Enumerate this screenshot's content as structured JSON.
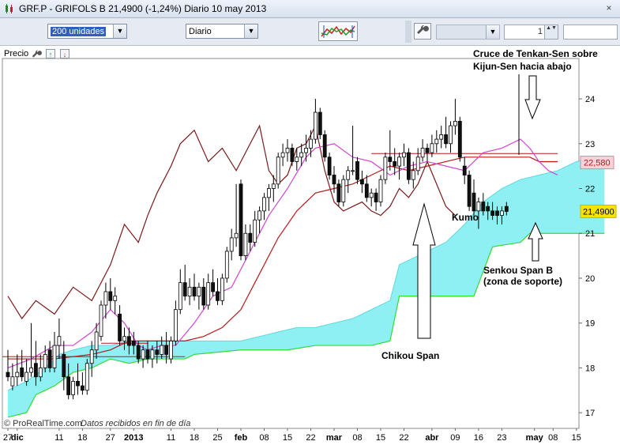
{
  "window": {
    "title": "GRF.P - GRIFOLS B   21,4900 (-1,24%)   Diario  10 may 2013",
    "close_glyph": "×"
  },
  "toolbar": {
    "units_value": "200 unidades",
    "period_value": "Diario",
    "spin_value": "1",
    "dropdown_arrow": "▼",
    "spin_arrows": "▲▼"
  },
  "chart_header": {
    "label": "Precio",
    "up_glyph": "↑",
    "down_glyph": "↓"
  },
  "icons": {
    "app": "candlestick-app-icon",
    "close": "close-icon",
    "wrench": "wrench-icon",
    "chart_style": "chart-indicator-icon"
  },
  "colors": {
    "kumo_fill": "#8ff0f4",
    "senkou_b": "#33dd33",
    "senkou_a": "#8ff0f4",
    "tenkan": "#d045d0",
    "kijun": "#b81818",
    "chikou": "#7a1a1a",
    "price_tag_yellow": "#f7e300",
    "price_tag_pink": "#f7d2da"
  },
  "chart_data": {
    "type": "candlestick",
    "instrument": "GRF.P - GRIFOLS B",
    "last_price": "21,4900",
    "change": "-1,24%",
    "timeframe": "Diario",
    "ylim": [
      16.65,
      24.9
    ],
    "y_ticks": [
      17,
      18,
      19,
      20,
      21,
      22,
      23,
      24
    ],
    "price_labels": {
      "kijun": "22,580",
      "last": "21,4900"
    },
    "x_ticks": [
      {
        "label": "27",
        "day": 0
      },
      {
        "label": "dic",
        "day": 2,
        "bold": true
      },
      {
        "label": "11",
        "day": 11
      },
      {
        "label": "18",
        "day": 16
      },
      {
        "label": "27",
        "day": 22
      },
      {
        "label": "2013",
        "day": 27,
        "bold": true
      },
      {
        "label": "11",
        "day": 35
      },
      {
        "label": "18",
        "day": 40
      },
      {
        "label": "25",
        "day": 45
      },
      {
        "label": "feb",
        "day": 50,
        "bold": true
      },
      {
        "label": "08",
        "day": 55
      },
      {
        "label": "15",
        "day": 60
      },
      {
        "label": "22",
        "day": 65
      },
      {
        "label": "mar",
        "day": 70,
        "bold": true
      },
      {
        "label": "08",
        "day": 75
      },
      {
        "label": "15",
        "day": 80
      },
      {
        "label": "22",
        "day": 85
      },
      {
        "label": "abr",
        "day": 91,
        "bold": true
      },
      {
        "label": "09",
        "day": 96
      },
      {
        "label": "16",
        "day": 101
      },
      {
        "label": "23",
        "day": 106
      },
      {
        "label": "may",
        "day": 113,
        "bold": true
      },
      {
        "label": "08",
        "day": 117
      },
      {
        "label": "15",
        "day": 122
      }
    ],
    "closes": [
      17.8,
      17.8,
      17.9,
      17.8,
      17.9,
      18.0,
      17.9,
      17.9,
      18.2,
      18.0,
      18.3,
      18.6,
      17.9,
      17.8,
      17.5,
      17.6,
      17.6,
      17.9,
      18.2,
      18.5,
      18.8,
      19.4,
      19.5,
      19.7,
      19.4,
      18.7,
      18.7,
      18.5,
      18.4,
      18.2,
      18.3,
      18.4,
      18.3,
      18.3,
      18.6,
      18.4,
      19.0,
      19.6,
      19.8,
      19.6,
      19.7,
      19.7,
      19.5,
      19.8,
      19.9,
      19.7,
      19.6,
      19.9,
      20.5,
      20.9,
      22.2,
      21.0,
      20.8,
      20.9,
      21.3,
      21.5,
      21.8,
      22.0,
      22.1,
      22.7,
      22.8,
      22.9,
      22.7,
      22.6,
      22.8,
      22.9,
      23.1,
      23.2,
      22.9,
      22.3,
      22.1,
      21.9,
      21.9,
      22.2,
      22.4,
      22.4,
      22.2,
      22.1,
      21.8,
      21.8,
      21.7,
      22.2,
      22.7,
      22.6,
      22.6,
      22.7,
      22.8,
      22.4,
      22.4,
      22.7,
      22.9,
      22.8,
      23.0,
      23.1,
      23.2,
      23.2,
      23.4,
      23.1,
      22.5,
      22.3,
      21.8,
      21.6,
      21.5,
      21.5,
      21.6,
      21.5,
      21.5,
      21.4,
      21.5,
      21.5
    ],
    "candles": [
      {
        "o": 17.9,
        "h": 18.4,
        "l": 17.7,
        "c": 17.8
      },
      {
        "o": 17.6,
        "h": 18.1,
        "l": 17.5,
        "c": 17.8
      },
      {
        "o": 17.8,
        "h": 18.3,
        "l": 17.6,
        "c": 17.9
      },
      {
        "o": 18.0,
        "h": 18.4,
        "l": 17.7,
        "c": 17.8
      },
      {
        "o": 17.7,
        "h": 18.2,
        "l": 17.6,
        "c": 17.9
      },
      {
        "o": 17.9,
        "h": 19.0,
        "l": 17.8,
        "c": 18.0
      },
      {
        "o": 18.1,
        "h": 18.6,
        "l": 17.6,
        "c": 17.8
      },
      {
        "o": 17.8,
        "h": 18.3,
        "l": 17.7,
        "c": 18.0
      },
      {
        "o": 18.0,
        "h": 18.5,
        "l": 17.9,
        "c": 18.3
      },
      {
        "o": 18.4,
        "h": 18.6,
        "l": 17.9,
        "c": 18.0
      },
      {
        "o": 18.0,
        "h": 18.8,
        "l": 17.9,
        "c": 18.5
      },
      {
        "o": 18.5,
        "h": 19.1,
        "l": 18.2,
        "c": 18.7
      },
      {
        "o": 18.3,
        "h": 18.6,
        "l": 17.5,
        "c": 17.8
      },
      {
        "o": 17.8,
        "h": 18.1,
        "l": 17.3,
        "c": 17.4
      },
      {
        "o": 17.4,
        "h": 17.8,
        "l": 17.3,
        "c": 17.7
      },
      {
        "o": 17.7,
        "h": 18.1,
        "l": 17.4,
        "c": 17.6
      },
      {
        "o": 17.6,
        "h": 17.9,
        "l": 17.4,
        "c": 17.5
      },
      {
        "o": 17.5,
        "h": 18.2,
        "l": 17.4,
        "c": 18.1
      },
      {
        "o": 18.1,
        "h": 18.6,
        "l": 17.8,
        "c": 18.4
      },
      {
        "o": 18.4,
        "h": 19.0,
        "l": 18.2,
        "c": 18.8
      },
      {
        "o": 18.7,
        "h": 19.5,
        "l": 18.6,
        "c": 19.4
      },
      {
        "o": 19.4,
        "h": 19.9,
        "l": 19.1,
        "c": 19.7
      },
      {
        "o": 19.7,
        "h": 20.0,
        "l": 19.3,
        "c": 19.5
      },
      {
        "o": 19.5,
        "h": 19.8,
        "l": 19.2,
        "c": 19.6
      },
      {
        "o": 19.2,
        "h": 19.4,
        "l": 18.5,
        "c": 18.6
      },
      {
        "o": 18.6,
        "h": 18.9,
        "l": 18.4,
        "c": 18.7
      },
      {
        "o": 18.7,
        "h": 18.9,
        "l": 18.3,
        "c": 18.5
      },
      {
        "o": 18.6,
        "h": 18.8,
        "l": 18.3,
        "c": 18.5
      },
      {
        "o": 18.5,
        "h": 18.6,
        "l": 18.1,
        "c": 18.2
      },
      {
        "o": 18.2,
        "h": 18.5,
        "l": 18.0,
        "c": 18.4
      },
      {
        "o": 18.4,
        "h": 18.6,
        "l": 18.1,
        "c": 18.2
      },
      {
        "o": 18.2,
        "h": 18.5,
        "l": 18.0,
        "c": 18.4
      },
      {
        "o": 18.4,
        "h": 18.6,
        "l": 18.1,
        "c": 18.3
      },
      {
        "o": 18.3,
        "h": 18.7,
        "l": 18.2,
        "c": 18.5
      },
      {
        "o": 18.5,
        "h": 18.8,
        "l": 18.1,
        "c": 18.3
      },
      {
        "o": 18.2,
        "h": 18.7,
        "l": 18.1,
        "c": 18.6
      },
      {
        "o": 18.6,
        "h": 19.5,
        "l": 18.5,
        "c": 19.3
      },
      {
        "o": 19.3,
        "h": 20.2,
        "l": 19.2,
        "c": 19.9
      },
      {
        "o": 19.9,
        "h": 20.3,
        "l": 19.5,
        "c": 19.6
      },
      {
        "o": 19.6,
        "h": 20.0,
        "l": 19.4,
        "c": 19.8
      },
      {
        "o": 19.8,
        "h": 20.1,
        "l": 19.5,
        "c": 19.6
      },
      {
        "o": 19.6,
        "h": 19.9,
        "l": 19.3,
        "c": 19.8
      },
      {
        "o": 19.8,
        "h": 20.0,
        "l": 19.3,
        "c": 19.4
      },
      {
        "o": 19.4,
        "h": 20.1,
        "l": 19.3,
        "c": 19.9
      },
      {
        "o": 19.9,
        "h": 20.2,
        "l": 19.6,
        "c": 19.7
      },
      {
        "o": 19.7,
        "h": 20.0,
        "l": 19.4,
        "c": 19.5
      },
      {
        "o": 19.5,
        "h": 20.1,
        "l": 19.4,
        "c": 20.0
      },
      {
        "o": 20.0,
        "h": 20.7,
        "l": 19.9,
        "c": 20.6
      },
      {
        "o": 20.6,
        "h": 21.1,
        "l": 20.4,
        "c": 20.9
      },
      {
        "o": 20.9,
        "h": 22.1,
        "l": 20.7,
        "c": 21.0
      },
      {
        "o": 22.1,
        "h": 22.2,
        "l": 20.4,
        "c": 20.5
      },
      {
        "o": 20.5,
        "h": 21.2,
        "l": 20.4,
        "c": 21.0
      },
      {
        "o": 21.0,
        "h": 21.2,
        "l": 20.6,
        "c": 20.8
      },
      {
        "o": 20.8,
        "h": 21.5,
        "l": 20.7,
        "c": 21.3
      },
      {
        "o": 21.3,
        "h": 21.6,
        "l": 21.0,
        "c": 21.5
      },
      {
        "o": 21.5,
        "h": 21.9,
        "l": 21.3,
        "c": 21.8
      },
      {
        "o": 21.8,
        "h": 22.1,
        "l": 21.5,
        "c": 22.0
      },
      {
        "o": 22.0,
        "h": 22.3,
        "l": 21.7,
        "c": 22.1
      },
      {
        "o": 22.1,
        "h": 22.8,
        "l": 22.0,
        "c": 22.7
      },
      {
        "o": 22.7,
        "h": 23.0,
        "l": 22.5,
        "c": 22.8
      },
      {
        "o": 22.8,
        "h": 23.1,
        "l": 22.6,
        "c": 22.9
      },
      {
        "o": 22.9,
        "h": 23.0,
        "l": 22.5,
        "c": 22.6
      },
      {
        "o": 22.6,
        "h": 22.9,
        "l": 22.4,
        "c": 22.7
      },
      {
        "o": 22.7,
        "h": 23.0,
        "l": 22.5,
        "c": 22.8
      },
      {
        "o": 22.8,
        "h": 23.2,
        "l": 22.6,
        "c": 22.9
      },
      {
        "o": 22.9,
        "h": 23.3,
        "l": 22.7,
        "c": 23.1
      },
      {
        "o": 23.1,
        "h": 24.0,
        "l": 23.0,
        "c": 23.7
      },
      {
        "o": 23.7,
        "h": 23.8,
        "l": 23.1,
        "c": 23.2
      },
      {
        "o": 23.2,
        "h": 23.3,
        "l": 22.6,
        "c": 22.7
      },
      {
        "o": 22.7,
        "h": 22.8,
        "l": 22.2,
        "c": 22.3
      },
      {
        "o": 22.3,
        "h": 22.5,
        "l": 21.9,
        "c": 22.1
      },
      {
        "o": 22.1,
        "h": 22.2,
        "l": 21.6,
        "c": 21.7
      },
      {
        "o": 21.7,
        "h": 22.3,
        "l": 21.6,
        "c": 22.2
      },
      {
        "o": 22.2,
        "h": 22.5,
        "l": 21.9,
        "c": 22.4
      },
      {
        "o": 22.4,
        "h": 23.4,
        "l": 22.3,
        "c": 22.4
      },
      {
        "o": 22.6,
        "h": 22.7,
        "l": 22.1,
        "c": 22.2
      },
      {
        "o": 22.2,
        "h": 22.4,
        "l": 21.9,
        "c": 22.1
      },
      {
        "o": 22.1,
        "h": 22.3,
        "l": 21.7,
        "c": 21.8
      },
      {
        "o": 21.8,
        "h": 22.0,
        "l": 21.6,
        "c": 21.9
      },
      {
        "o": 21.9,
        "h": 22.0,
        "l": 21.5,
        "c": 21.7
      },
      {
        "o": 21.7,
        "h": 22.3,
        "l": 21.6,
        "c": 22.2
      },
      {
        "o": 22.2,
        "h": 22.8,
        "l": 22.1,
        "c": 22.7
      },
      {
        "o": 22.7,
        "h": 23.3,
        "l": 22.4,
        "c": 22.6
      },
      {
        "o": 22.6,
        "h": 22.9,
        "l": 22.3,
        "c": 22.5
      },
      {
        "o": 22.5,
        "h": 22.8,
        "l": 22.2,
        "c": 22.7
      },
      {
        "o": 22.7,
        "h": 23.0,
        "l": 22.5,
        "c": 22.8
      },
      {
        "o": 22.8,
        "h": 22.9,
        "l": 22.1,
        "c": 22.2
      },
      {
        "o": 22.2,
        "h": 22.6,
        "l": 22.0,
        "c": 22.4
      },
      {
        "o": 22.4,
        "h": 22.9,
        "l": 22.3,
        "c": 22.7
      },
      {
        "o": 22.7,
        "h": 23.1,
        "l": 22.6,
        "c": 22.9
      },
      {
        "o": 22.9,
        "h": 23.0,
        "l": 22.6,
        "c": 22.8
      },
      {
        "o": 22.8,
        "h": 23.2,
        "l": 22.7,
        "c": 23.0
      },
      {
        "o": 23.0,
        "h": 23.3,
        "l": 22.8,
        "c": 23.1
      },
      {
        "o": 23.1,
        "h": 23.4,
        "l": 22.9,
        "c": 23.2
      },
      {
        "o": 23.2,
        "h": 23.6,
        "l": 22.9,
        "c": 23.0
      },
      {
        "o": 23.0,
        "h": 23.5,
        "l": 22.8,
        "c": 23.4
      },
      {
        "o": 23.4,
        "h": 24.0,
        "l": 23.2,
        "c": 23.5
      },
      {
        "o": 23.5,
        "h": 23.6,
        "l": 22.6,
        "c": 22.7
      },
      {
        "o": 22.5,
        "h": 22.7,
        "l": 22.1,
        "c": 22.3
      },
      {
        "o": 22.3,
        "h": 22.4,
        "l": 21.5,
        "c": 21.6
      },
      {
        "o": 21.9,
        "h": 22.2,
        "l": 21.3,
        "c": 21.5
      },
      {
        "o": 21.5,
        "h": 21.8,
        "l": 21.1,
        "c": 21.7
      },
      {
        "o": 21.7,
        "h": 21.9,
        "l": 21.4,
        "c": 21.5
      },
      {
        "o": 21.6,
        "h": 21.7,
        "l": 21.3,
        "c": 21.5
      },
      {
        "o": 21.5,
        "h": 21.7,
        "l": 21.3,
        "c": 21.4
      },
      {
        "o": 21.5,
        "h": 21.6,
        "l": 21.2,
        "c": 21.4
      },
      {
        "o": 21.4,
        "h": 21.6,
        "l": 21.2,
        "c": 21.5
      },
      {
        "o": 21.6,
        "h": 21.7,
        "l": 21.4,
        "c": 21.49
      }
    ],
    "tenkan": {
      "x": [
        0,
        5,
        10,
        14,
        18,
        22,
        25,
        28,
        30,
        33,
        36,
        40,
        44,
        48,
        52,
        56,
        60,
        64,
        66,
        70,
        74,
        78,
        82,
        86,
        90,
        94,
        98,
        102,
        106,
        110,
        112,
        114,
        116,
        118
      ],
      "y": [
        18.0,
        18.2,
        18.5,
        18.5,
        18.8,
        19.3,
        19.0,
        18.5,
        18.4,
        18.5,
        18.5,
        19.0,
        19.6,
        19.8,
        20.6,
        21.4,
        22.0,
        22.7,
        22.9,
        23.0,
        22.7,
        22.6,
        22.3,
        22.5,
        22.6,
        22.5,
        22.4,
        22.8,
        22.9,
        23.1,
        22.9,
        22.6,
        22.4,
        22.3
      ]
    },
    "kijun": {
      "x": [
        0,
        10,
        18,
        22,
        26,
        30,
        34,
        38,
        42,
        46,
        50,
        54,
        58,
        62,
        66,
        70,
        74,
        78,
        82,
        86,
        90,
        94,
        98,
        102,
        106,
        110,
        112,
        114,
        118
      ],
      "y": [
        18.2,
        18.2,
        18.3,
        18.4,
        18.6,
        18.6,
        18.6,
        18.6,
        18.7,
        18.9,
        19.3,
        20.1,
        20.9,
        21.5,
        21.9,
        22.0,
        22.1,
        22.3,
        22.5,
        22.4,
        22.5,
        22.6,
        22.7,
        22.7,
        22.7,
        22.7,
        22.7,
        22.6,
        22.6
      ]
    },
    "chikou": {
      "x": [
        0,
        3,
        6,
        10,
        14,
        18,
        22,
        25,
        28,
        30,
        32,
        35,
        37,
        40,
        43,
        46,
        49,
        52,
        54,
        56,
        58,
        60,
        62,
        64,
        66,
        68,
        70,
        72,
        74,
        76,
        78,
        80,
        82,
        84,
        86,
        88,
        90,
        92,
        94,
        96
      ],
      "y": [
        19.6,
        19.1,
        19.5,
        19.2,
        19.8,
        19.5,
        20.3,
        21.2,
        20.8,
        21.4,
        21.9,
        22.5,
        23.0,
        23.3,
        22.6,
        22.9,
        22.4,
        23.0,
        23.4,
        22.4,
        22.1,
        22.3,
        22.9,
        23.0,
        23.4,
        22.4,
        21.7,
        21.5,
        21.6,
        21.7,
        21.5,
        21.4,
        21.6,
        22.0,
        21.8,
        22.1,
        22.6,
        22.1,
        21.6,
        21.4
      ]
    },
    "senkou_a": {
      "x": [
        0,
        4,
        8,
        11,
        14,
        18,
        22,
        26,
        30,
        34,
        38,
        42,
        46,
        50,
        54,
        58,
        62,
        66,
        70,
        74,
        78,
        82,
        84,
        86,
        88,
        90,
        94,
        98,
        102,
        106,
        110,
        114,
        118,
        122,
        126,
        128
      ],
      "y": [
        17.5,
        17.7,
        18.0,
        18.3,
        18.4,
        18.5,
        18.5,
        18.6,
        18.6,
        18.6,
        18.6,
        18.6,
        18.6,
        18.6,
        18.7,
        18.8,
        18.9,
        18.9,
        19.0,
        19.1,
        19.3,
        19.5,
        20.3,
        20.4,
        20.5,
        20.6,
        20.8,
        21.2,
        21.7,
        22.0,
        22.2,
        22.3,
        22.4,
        22.6,
        22.7,
        22.6
      ]
    },
    "senkou_b": {
      "x": [
        0,
        4,
        6,
        8,
        10,
        14,
        18,
        22,
        26,
        30,
        34,
        38,
        40,
        50,
        60,
        66,
        70,
        74,
        78,
        82,
        84,
        86,
        100,
        104,
        110,
        112,
        128
      ],
      "y": [
        16.9,
        17.0,
        17.4,
        17.5,
        17.6,
        17.9,
        18.0,
        18.2,
        18.1,
        18.2,
        18.2,
        18.2,
        18.3,
        18.4,
        18.4,
        18.5,
        18.5,
        18.5,
        18.5,
        18.6,
        19.6,
        19.6,
        19.6,
        20.7,
        20.8,
        21.0,
        21.0
      ]
    },
    "annotations": [
      {
        "text": "Cruce de Tenkan-Sen sobre",
        "id": "tk1"
      },
      {
        "text": "Kijun-Sen hacia abajo",
        "id": "tk2"
      },
      {
        "text": "Kumo",
        "id": "kumo"
      },
      {
        "text": "Chikou Span",
        "id": "chikou"
      },
      {
        "text": "Senkou Span B",
        "id": "sb1"
      },
      {
        "text": "(zona de soporte)",
        "id": "sb2"
      }
    ],
    "footer": {
      "copyright": "© ProRealTime.com",
      "note": "Datos recibidos en fin de día"
    }
  }
}
